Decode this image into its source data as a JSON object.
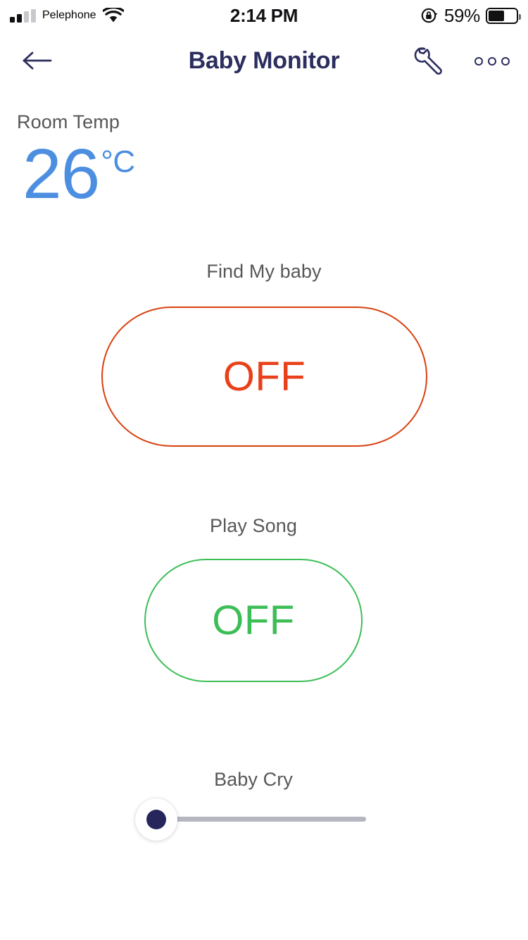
{
  "status_bar": {
    "carrier": "Pelephone",
    "time": "2:14 PM",
    "battery_percent": "59%",
    "battery_level": 59,
    "signal_bars_filled": 2,
    "signal_bars_total": 4,
    "icons": {
      "signal": "signal-bars-icon",
      "wifi": "wifi-icon",
      "rotation_lock": "rotation-lock-icon",
      "battery": "battery-icon"
    }
  },
  "header": {
    "title": "Baby Monitor",
    "back_icon": "back-arrow-icon",
    "settings_icon": "wrench-icon",
    "more_icon": "more-options-icon",
    "title_color": "#2b2e5e"
  },
  "room_temp": {
    "label": "Room Temp",
    "value": "26",
    "unit": "°C",
    "color": "#4c8ee0"
  },
  "controls": {
    "find_my_baby": {
      "label": "Find My baby",
      "state": "OFF",
      "color": "#e8411a"
    },
    "play_song": {
      "label": "Play Song",
      "state": "OFF",
      "color": "#3cbe57"
    },
    "baby_cry": {
      "label": "Baby Cry",
      "value": 0,
      "min": 0,
      "max": 100,
      "thumb_color": "#26265c",
      "track_color": "#b6b6c0"
    }
  }
}
